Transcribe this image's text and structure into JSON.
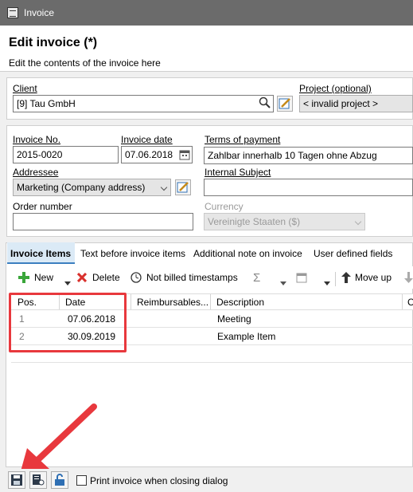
{
  "window": {
    "title": "Invoice"
  },
  "header": {
    "title": "Edit invoice (*)",
    "subtitle": "Edit the contents of the invoice here"
  },
  "client": {
    "label": "Client",
    "value": "[9] Tau GmbH"
  },
  "project": {
    "label": "Project (optional)",
    "value": "< invalid project >"
  },
  "invoice_no": {
    "label": "Invoice No.",
    "value": "2015-0020"
  },
  "invoice_date": {
    "label": "Invoice date",
    "value": "07.06.2018"
  },
  "terms": {
    "label": "Terms of payment",
    "value": "Zahlbar innerhalb 10 Tagen ohne Abzug"
  },
  "addressee": {
    "label": "Addressee",
    "value": "Marketing (Company address)"
  },
  "internal_subject": {
    "label": "Internal Subject",
    "value": ""
  },
  "order_number": {
    "label": "Order number",
    "value": ""
  },
  "currency": {
    "label": "Currency",
    "value": "Vereinigte Staaten ($)"
  },
  "tabs": [
    {
      "label": "Invoice Items",
      "active": true
    },
    {
      "label": "Text before invoice items"
    },
    {
      "label": "Additional note on invoice"
    },
    {
      "label": "User defined fields"
    }
  ],
  "toolbar": {
    "new": "New",
    "delete": "Delete",
    "not_billed": "Not billed timestamps",
    "move_up": "Move up"
  },
  "grid": {
    "columns": [
      "Pos.",
      "Date",
      "Reimbursables...",
      "Description",
      "C"
    ],
    "rows": [
      {
        "pos": "1",
        "date": "07.06.2018",
        "reimb": "",
        "description": "Meeting"
      },
      {
        "pos": "2",
        "date": "30.09.2019",
        "reimb": "",
        "description": "Example Item"
      }
    ]
  },
  "footer": {
    "print_label": "Print invoice when closing dialog",
    "print_checked": false
  },
  "colors": {
    "accent": "#3c7fc0",
    "highlight": "#e8383d",
    "titlebar": "#6b6b6b"
  }
}
